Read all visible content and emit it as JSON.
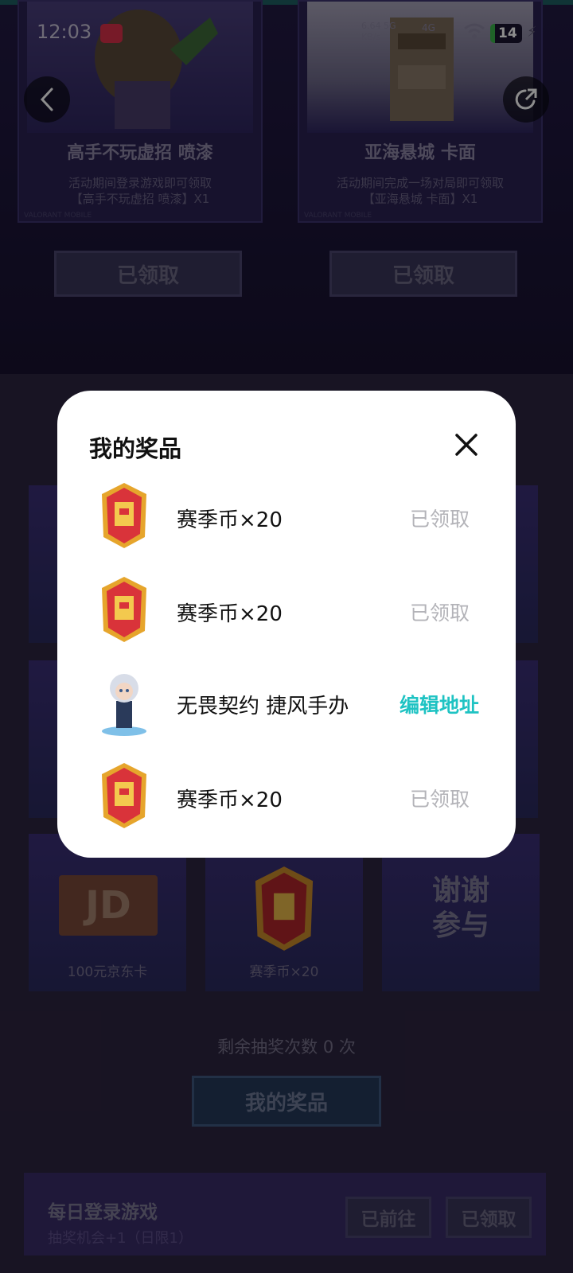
{
  "status_bar": {
    "time": "12:03",
    "speed": "6.64 5G",
    "speed_unit": "KB/s",
    "network": "4G",
    "battery": "14"
  },
  "background": {
    "cards": [
      {
        "title": "高手不玩虚招 喷漆",
        "desc_line1": "活动期间登录游戏即可领取",
        "desc_line2": "【高手不玩虚招 喷漆】X1",
        "tag": "VALORANT MOBILE",
        "button": "已领取"
      },
      {
        "title": "亚海悬城 卡面",
        "desc_line1": "活动期间完成一场对局即可领取",
        "desc_line2": "【亚海悬城 卡面】X1",
        "tag": "VALORANT MOBILE",
        "button": "已领取"
      }
    ],
    "grid_items": [
      {
        "label": "100元京东卡",
        "card_text": "JD"
      },
      {
        "label": "赛季币×20"
      },
      {
        "label": "谢谢\n参与",
        "line1": "谢谢",
        "line2": "参与"
      }
    ],
    "remaining_label": "剩余抽奖次数 0 次",
    "my_prizes_button": "我的奖品",
    "task": {
      "title": "每日登录游戏",
      "subtitle": "抽奖机会+1（日限1）",
      "btn_go": "已前往",
      "btn_claimed": "已领取"
    }
  },
  "modal": {
    "title": "我的奖品",
    "close_icon": "close-icon",
    "prizes": [
      {
        "name": "赛季币×20",
        "action": "已领取",
        "icon": "season-coin-icon"
      },
      {
        "name": "赛季币×20",
        "action": "已领取",
        "icon": "season-coin-icon"
      },
      {
        "name": "无畏契约 捷风手办",
        "action": "编辑地址",
        "icon": "figure-icon"
      },
      {
        "name": "赛季币×20",
        "action": "已领取",
        "icon": "season-coin-icon"
      }
    ],
    "colors": {
      "edit_action": "#1fc3c3",
      "claimed_action": "#b3b3b8"
    }
  }
}
